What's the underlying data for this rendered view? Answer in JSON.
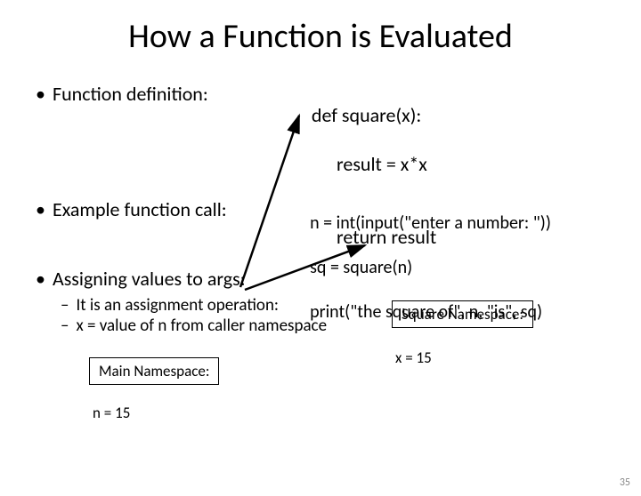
{
  "title": "How a Function is Evaluated",
  "bullets": {
    "b1": "Function definition:",
    "b2": "Example function call:",
    "b3": "Assigning values to args:"
  },
  "code": {
    "def": "def square(x):",
    "def_l2": "result = x*x",
    "def_l3": "return result",
    "call_l1": "n = int(input(\"enter a number: \"))",
    "call_l2": "sq = square(n)",
    "call_l3": "print(\"the square of\", n, \"is\", sq)"
  },
  "sub": {
    "s1": "It is an assignment operation:",
    "s2": "x = value of n from caller namespace"
  },
  "ns": {
    "main_label": "Main Namespace:",
    "main_val": "n = 15",
    "sq_label": "Square Namespace:",
    "sq_val": "x = 15"
  },
  "page": "35"
}
